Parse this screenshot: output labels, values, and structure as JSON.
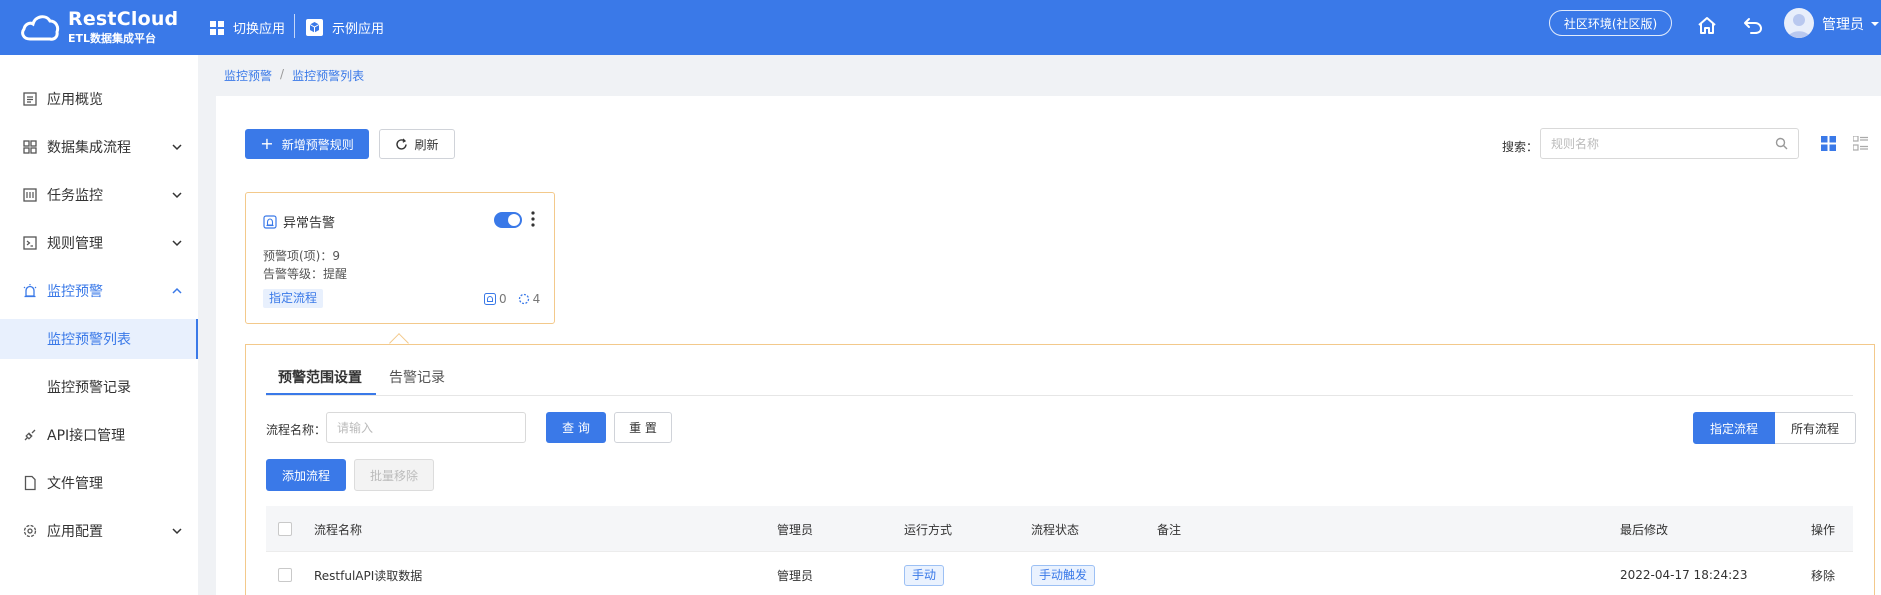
{
  "header": {
    "brand": "RestCloud",
    "brand_sub": "ETL数据集成平台",
    "nav": [
      {
        "label": "切换应用",
        "icon": "grid-icon"
      },
      {
        "label": "示例应用",
        "icon": "cube-icon"
      }
    ],
    "env_button": "社区环境(社区版)",
    "user": "管理员"
  },
  "sidebar": {
    "items": [
      {
        "label": "应用概览",
        "icon": "overview-icon"
      },
      {
        "label": "数据集成流程",
        "icon": "flow-icon"
      },
      {
        "label": "任务监控",
        "icon": "task-icon"
      },
      {
        "label": "规则管理",
        "icon": "rule-icon"
      },
      {
        "label": "监控预警",
        "icon": "alarm-icon"
      },
      {
        "label": "API接口管理",
        "icon": "api-icon"
      },
      {
        "label": "文件管理",
        "icon": "file-icon"
      },
      {
        "label": "应用配置",
        "icon": "gear-icon"
      }
    ],
    "sub_items": [
      {
        "label": "监控预警列表"
      },
      {
        "label": "监控预警记录"
      }
    ]
  },
  "breadcrumb": [
    "监控预警",
    "监控预警列表"
  ],
  "toolbar": {
    "add_label": "新增预警规则",
    "refresh_label": "刷新",
    "search_label": "搜索：",
    "search_placeholder": "规则名称"
  },
  "card": {
    "title": "异常告警",
    "items_line": "预警项(项)：9",
    "level_line": "告警等级：提醒",
    "tag": "指定流程",
    "alert_count": "0",
    "run_count": "4",
    "enabled": true
  },
  "detail": {
    "tabs": [
      "预警范围设置",
      "告警记录"
    ],
    "filter_label": "流程名称：",
    "filter_placeholder": "请输入",
    "query_label": "查 询",
    "reset_label": "重 置",
    "add_flow_label": "添加流程",
    "batch_remove_label": "批量移除",
    "segment": [
      "指定流程",
      "所有流程"
    ],
    "columns": [
      "流程名称",
      "管理员",
      "运行方式",
      "流程状态",
      "备注",
      "最后修改",
      "操作"
    ],
    "rows": [
      {
        "name": "RestfulAPI读取数据",
        "owner": "管理员",
        "run_mode": "手动",
        "status": "手动触发",
        "note": "",
        "modified": "2022-04-17 18:24:23",
        "action": "移除"
      }
    ]
  },
  "colors": {
    "primary": "#3a79e8",
    "card_border": "#f3c98b",
    "sidebar_selected_bg": "#e8f0fd"
  }
}
